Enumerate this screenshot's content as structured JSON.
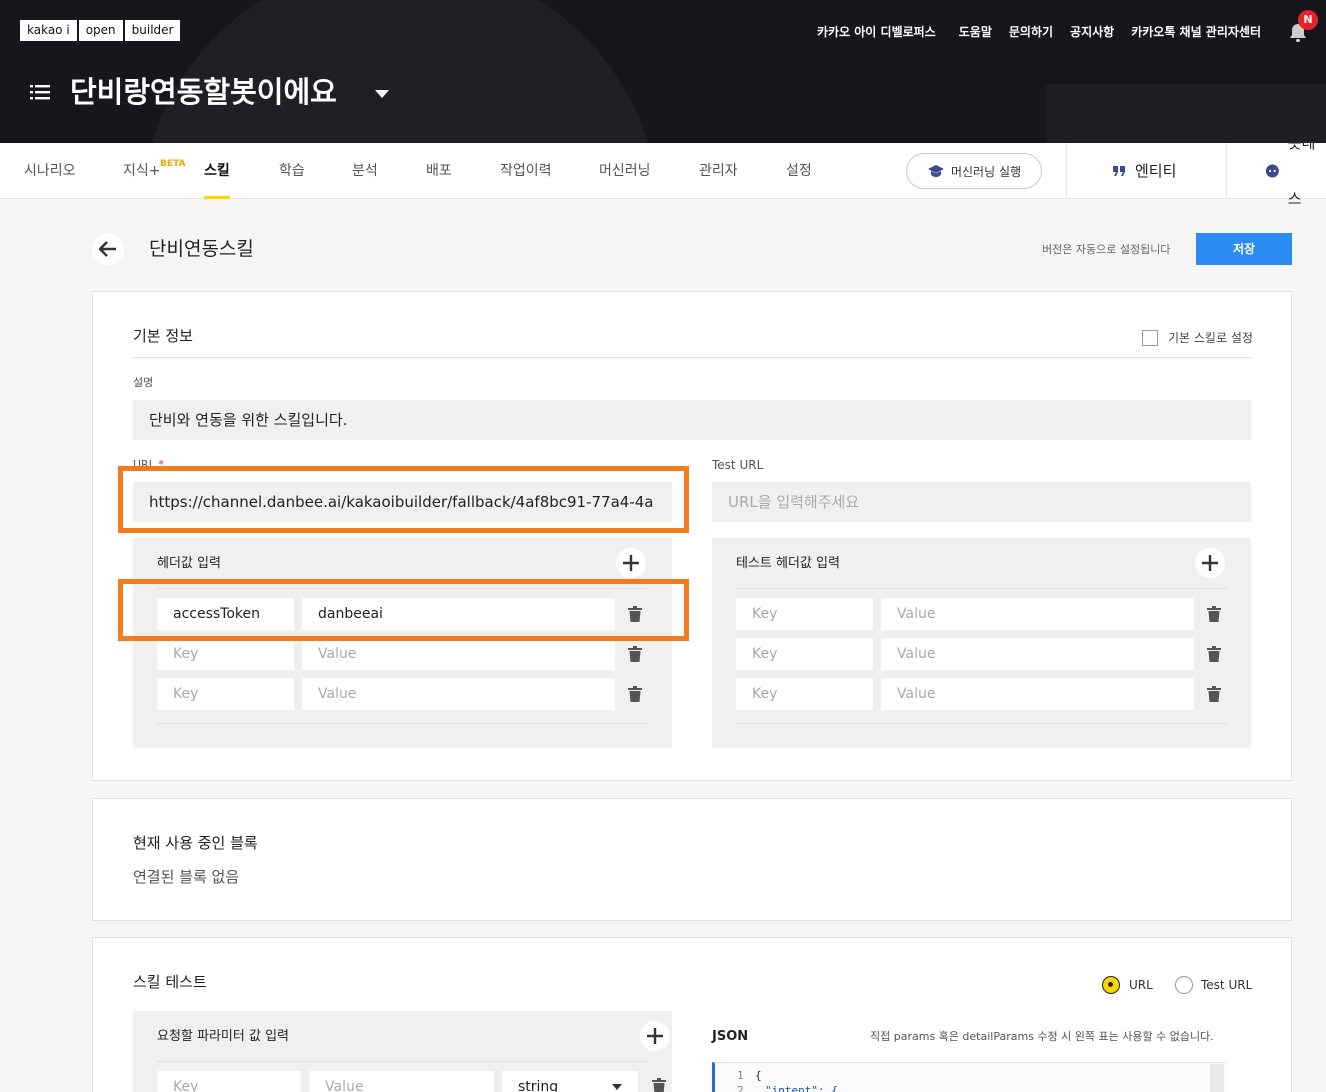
{
  "brand": {
    "logo_parts": [
      "kakao i",
      "open",
      "builder"
    ]
  },
  "top_nav": {
    "links": [
      "카카오 아이 디벨로퍼스",
      "도움말",
      "문의하기",
      "공지사항",
      "카카오톡 채널 관리자센터"
    ],
    "notification_badge": "N"
  },
  "bot": {
    "name": "단비랑연동할봇이에요"
  },
  "tabs": {
    "items": [
      "시나리오",
      "지식+",
      "스킬",
      "학습",
      "분석",
      "배포",
      "작업이력",
      "머신러닝",
      "관리자",
      "설정"
    ],
    "beta": "BETA",
    "active": "스킬",
    "ml_run": "머신러닝 실행",
    "entity": "엔티티",
    "bot_test": "봇테스"
  },
  "page": {
    "title": "단비연동스킬",
    "version_note": "버전은 자동으로 설정됩니다",
    "save": "저장"
  },
  "basic_info": {
    "title": "기본 정보",
    "default_skill_label": "기본 스킬로 설정",
    "description_label": "설명",
    "description_value": "단비와 연동을 위한 스킬입니다.",
    "url_label": "URL",
    "url_required": "*",
    "url_value": "https://channel.danbee.ai/kakaoibuilder/fallback/4af8bc91-77a4-4a",
    "test_url_label": "Test URL",
    "test_url_placeholder": "URL을 입력해주세요",
    "headers": {
      "title": "헤더값 입력",
      "rows": [
        {
          "key": "accessToken",
          "value": "danbeeai"
        },
        {
          "key": "Key",
          "value": "Value"
        },
        {
          "key": "Key",
          "value": "Value"
        }
      ]
    },
    "test_headers": {
      "title": "테스트 헤더값 입력",
      "rows": [
        {
          "key": "Key",
          "value": "Value"
        },
        {
          "key": "Key",
          "value": "Value"
        },
        {
          "key": "Key",
          "value": "Value"
        }
      ]
    }
  },
  "blocks": {
    "title": "현재 사용 중인 블록",
    "empty": "연결된 블록 없음"
  },
  "skill_test": {
    "title": "스킬 테스트",
    "radio_url": "URL",
    "radio_test_url": "Test URL",
    "params_title": "요청할 파라미터 값 입력",
    "param_key": "Key",
    "param_value": "Value",
    "param_type": "string",
    "json_title": "JSON",
    "json_note": "직접 params 혹은 detailParams 수정 시 왼쪽 표는 사용할 수 없습니다.",
    "code_line1": "1",
    "code_line1_text": "{",
    "code_line2": "2",
    "code_line2_text": "\"intent\": {"
  },
  "colors": {
    "highlight": "#f47c20",
    "accent": "#ffd500",
    "primary_button": "#2a8cf2",
    "header_bg": "#16161c"
  }
}
